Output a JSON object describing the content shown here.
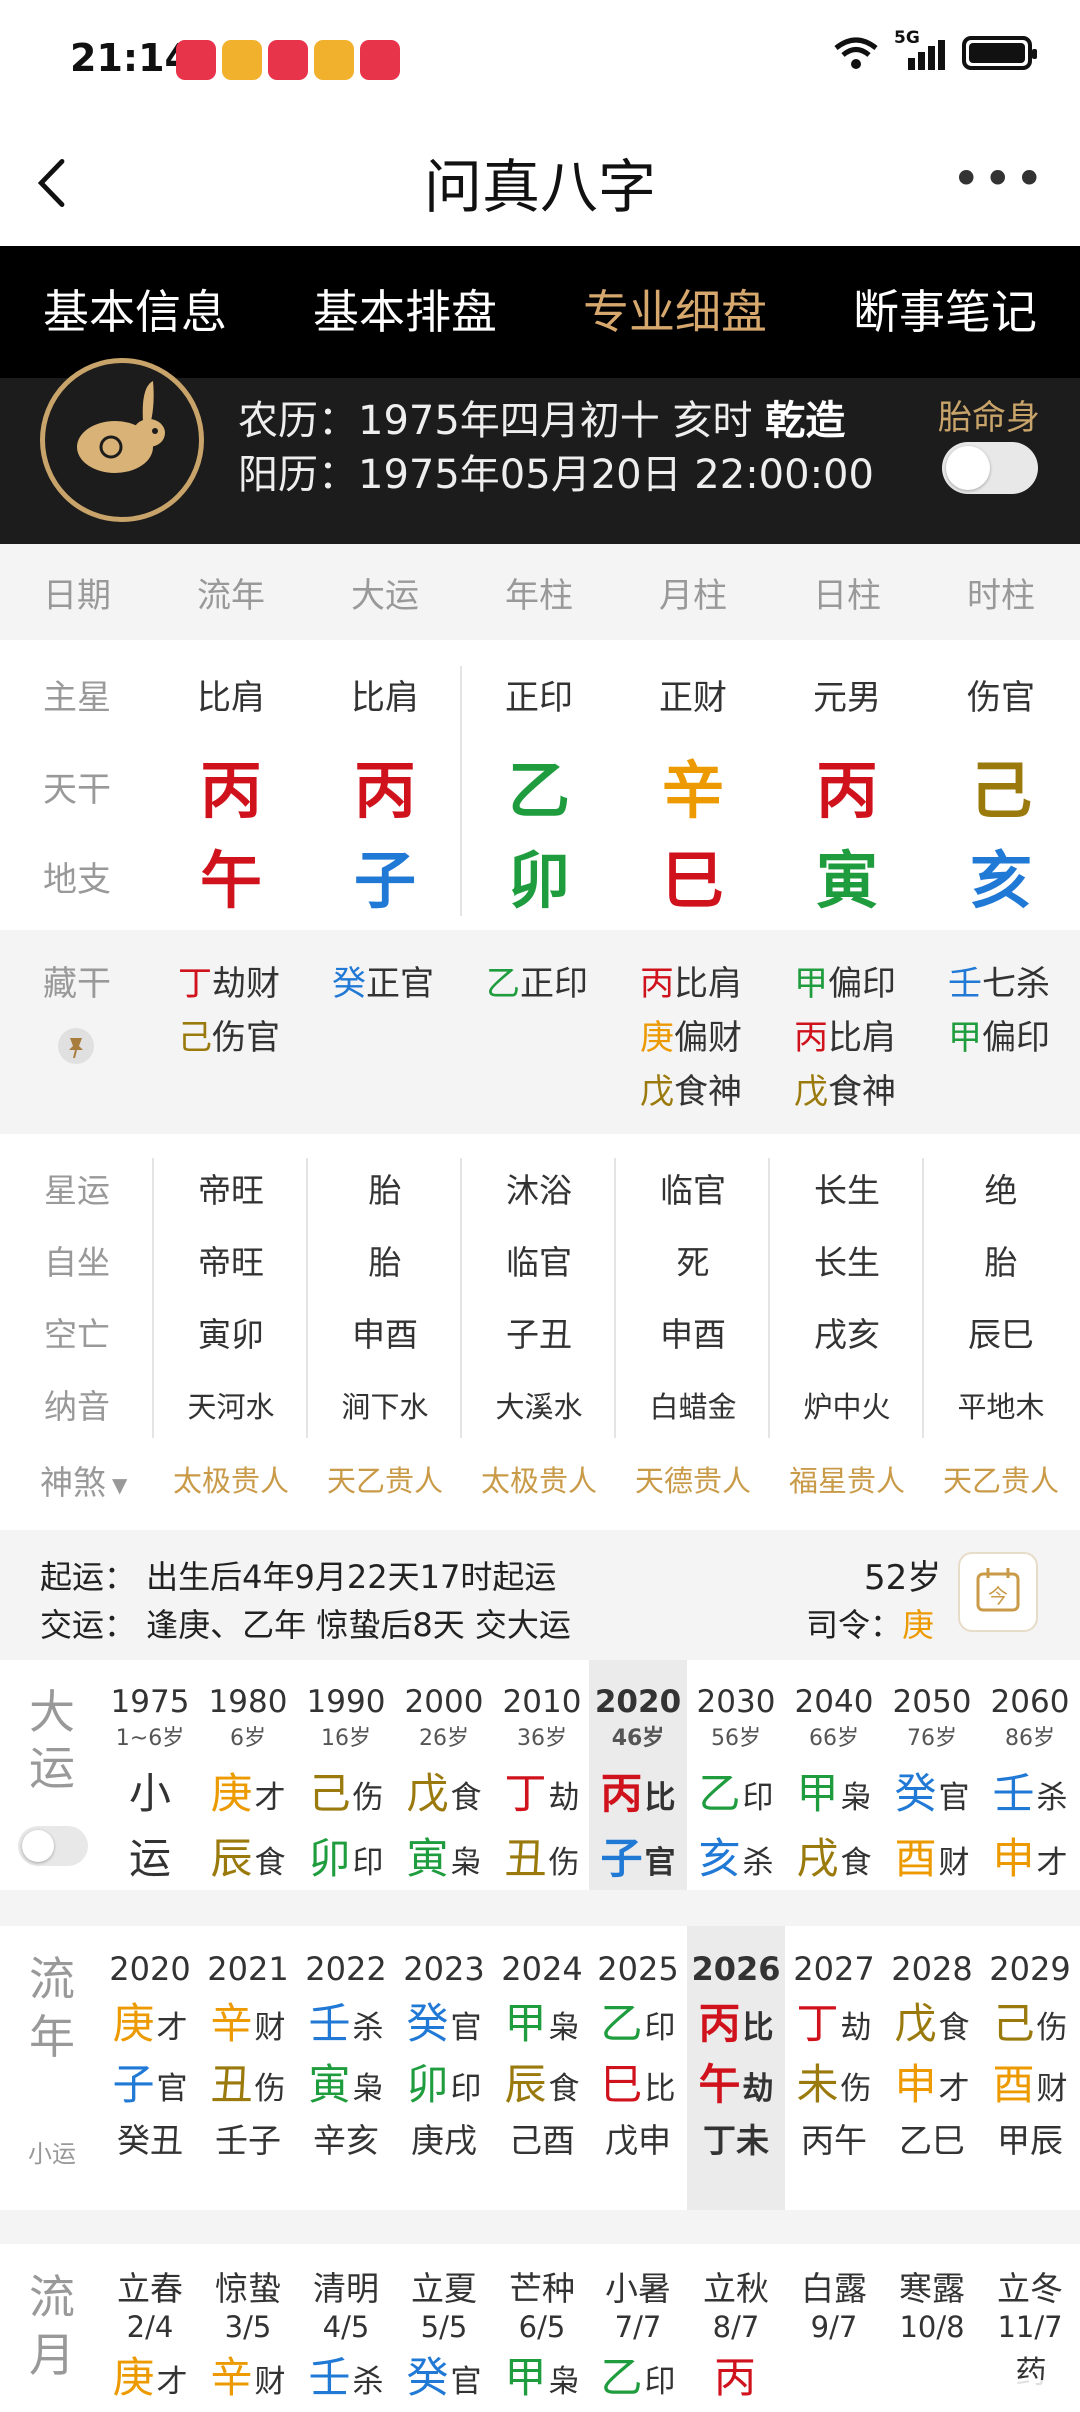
{
  "status_bar": {
    "time": "21:14",
    "network": "5G"
  },
  "nav": {
    "title": "问真八字"
  },
  "tabs": [
    "基本信息",
    "基本排盘",
    "专业细盘",
    "断事笔记"
  ],
  "active_tab": "专业细盘",
  "info": {
    "lunar_prefix": "农历：1975年四月初十 亥时 ",
    "lunar_gender": "乾造",
    "solar": "阳历：1975年05月20日 22:00:00",
    "taiming_label": "胎命身"
  },
  "columns": [
    "日期",
    "流年",
    "大运",
    "年柱",
    "月柱",
    "日柱",
    "时柱"
  ],
  "rows": {
    "labels": {
      "zhuxing": "主星",
      "tiangan": "天干",
      "dizhi": "地支",
      "canggan": "藏干"
    },
    "zhuxing": [
      "比肩",
      "比肩",
      "正印",
      "正财",
      "元男",
      "伤官"
    ],
    "tiangan": [
      "丙",
      "丙",
      "乙",
      "辛",
      "丙",
      "己"
    ],
    "dizhi": [
      "午",
      "子",
      "卯",
      "巳",
      "寅",
      "亥"
    ]
  },
  "canggan": [
    [
      {
        "g": "丁",
        "t": "劫财"
      },
      {
        "g": "己",
        "t": "伤官"
      }
    ],
    [
      {
        "g": "癸",
        "t": "正官"
      }
    ],
    [
      {
        "g": "乙",
        "t": "正印"
      }
    ],
    [
      {
        "g": "丙",
        "t": "比肩"
      },
      {
        "g": "庚",
        "t": "偏财"
      },
      {
        "g": "戊",
        "t": "食神"
      }
    ],
    [
      {
        "g": "甲",
        "t": "偏印"
      },
      {
        "g": "丙",
        "t": "比肩"
      },
      {
        "g": "戊",
        "t": "食神"
      }
    ],
    [
      {
        "g": "壬",
        "t": "七杀"
      },
      {
        "g": "甲",
        "t": "偏印"
      }
    ]
  ],
  "stars": {
    "labels": [
      "星运",
      "自坐",
      "空亡",
      "纳音"
    ],
    "xingyun": [
      "帝旺",
      "胎",
      "沐浴",
      "临官",
      "长生",
      "绝"
    ],
    "zizuo": [
      "帝旺",
      "胎",
      "临官",
      "死",
      "长生",
      "胎"
    ],
    "kongwang": [
      "寅卯",
      "申酉",
      "子丑",
      "申酉",
      "戌亥",
      "辰巳"
    ],
    "nayin": [
      "天河水",
      "涧下水",
      "大溪水",
      "白蜡金",
      "炉中火",
      "平地木"
    ]
  },
  "shensha": {
    "label": "神煞",
    "items": [
      "太极贵人",
      "天乙贵人",
      "太极贵人",
      "天德贵人",
      "福星贵人",
      "天乙贵人"
    ]
  },
  "qiyun": {
    "line1": "起运：  出生后4年9月22天17时起运",
    "line2": "交运：  逢庚、乙年 惊蛰后8天 交大运",
    "age": "52岁",
    "siling_label": "司令：",
    "siling": "庚"
  },
  "dayun": {
    "label": "大运",
    "cols": [
      {
        "year": "1975",
        "age": "1~6岁",
        "g": "小",
        "gs": "",
        "z": "运",
        "zs": ""
      },
      {
        "year": "1980",
        "age": "6岁",
        "g": "庚",
        "gs": "才",
        "z": "辰",
        "zs": "食"
      },
      {
        "year": "1990",
        "age": "16岁",
        "g": "己",
        "gs": "伤",
        "z": "卯",
        "zs": "印"
      },
      {
        "year": "2000",
        "age": "26岁",
        "g": "戊",
        "gs": "食",
        "z": "寅",
        "zs": "枭"
      },
      {
        "year": "2010",
        "age": "36岁",
        "g": "丁",
        "gs": "劫",
        "z": "丑",
        "zs": "伤"
      },
      {
        "year": "2020",
        "age": "46岁",
        "g": "丙",
        "gs": "比",
        "z": "子",
        "zs": "官"
      },
      {
        "year": "2030",
        "age": "56岁",
        "g": "乙",
        "gs": "印",
        "z": "亥",
        "zs": "杀"
      },
      {
        "year": "2040",
        "age": "66岁",
        "g": "甲",
        "gs": "枭",
        "z": "戌",
        "zs": "食"
      },
      {
        "year": "2050",
        "age": "76岁",
        "g": "癸",
        "gs": "官",
        "z": "酉",
        "zs": "财"
      },
      {
        "year": "2060",
        "age": "86岁",
        "g": "壬",
        "gs": "杀",
        "z": "申",
        "zs": "才"
      }
    ]
  },
  "liunian": {
    "label1": "流",
    "label2": "年",
    "sub": "小运",
    "cols": [
      {
        "year": "2020",
        "g": "庚",
        "gs": "才",
        "z": "子",
        "zs": "官",
        "x": "癸丑"
      },
      {
        "year": "2021",
        "g": "辛",
        "gs": "财",
        "z": "丑",
        "zs": "伤",
        "x": "壬子"
      },
      {
        "year": "2022",
        "g": "壬",
        "gs": "杀",
        "z": "寅",
        "zs": "枭",
        "x": "辛亥"
      },
      {
        "year": "2023",
        "g": "癸",
        "gs": "官",
        "z": "卯",
        "zs": "印",
        "x": "庚戌"
      },
      {
        "year": "2024",
        "g": "甲",
        "gs": "枭",
        "z": "辰",
        "zs": "食",
        "x": "己酉"
      },
      {
        "year": "2025",
        "g": "乙",
        "gs": "印",
        "z": "巳",
        "zs": "比",
        "x": "戊申"
      },
      {
        "year": "2026",
        "g": "丙",
        "gs": "比",
        "z": "午",
        "zs": "劫",
        "x": "丁未"
      },
      {
        "year": "2027",
        "g": "丁",
        "gs": "劫",
        "z": "未",
        "zs": "伤",
        "x": "丙午"
      },
      {
        "year": "2028",
        "g": "戊",
        "gs": "食",
        "z": "申",
        "zs": "才",
        "x": "乙巳"
      },
      {
        "year": "2029",
        "g": "己",
        "gs": "伤",
        "z": "酉",
        "zs": "财",
        "x": "甲辰"
      }
    ]
  },
  "liuyue": {
    "label1": "流",
    "label2": "月",
    "cols": [
      {
        "jie": "立春",
        "date": "2/4",
        "g": "庚",
        "gs": "才"
      },
      {
        "jie": "惊蛰",
        "date": "3/5",
        "g": "辛",
        "gs": "财"
      },
      {
        "jie": "清明",
        "date": "4/5",
        "g": "壬",
        "gs": "杀"
      },
      {
        "jie": "立夏",
        "date": "5/5",
        "g": "癸",
        "gs": "官"
      },
      {
        "jie": "芒种",
        "date": "6/5",
        "g": "甲",
        "gs": "枭"
      },
      {
        "jie": "小暑",
        "date": "7/7",
        "g": "乙",
        "gs": "印"
      },
      {
        "jie": "立秋",
        "date": "8/7",
        "g": "丙",
        "gs": ""
      },
      {
        "jie": "白露",
        "date": "9/7",
        "g": "",
        "gs": ""
      },
      {
        "jie": "寒露",
        "date": "10/8",
        "g": "",
        "gs": ""
      },
      {
        "jie": "立冬",
        "date": "11/7",
        "g": "",
        "gs": "药"
      }
    ]
  },
  "element_colors": {
    "fire": "#d0121c",
    "wood": "#1f9d3e",
    "metal": "#ec9a00",
    "earth": "#9b7a0d",
    "water": "#2179d6"
  }
}
